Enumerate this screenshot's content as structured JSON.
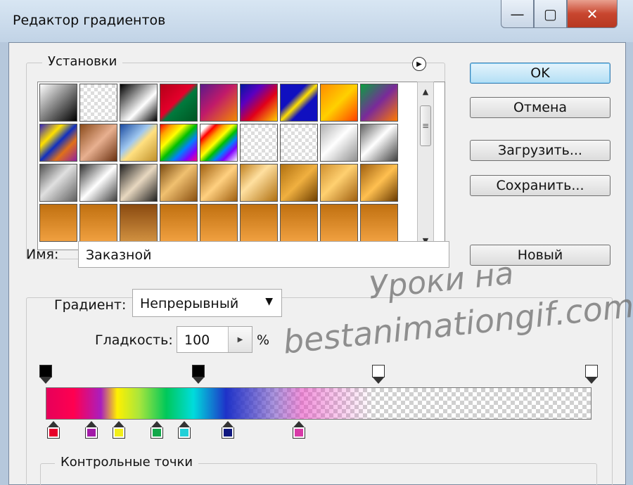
{
  "window": {
    "title": "Редактор градиентов",
    "min_icon": "minimize-icon",
    "max_icon": "maximize-icon",
    "close_icon": "close-icon",
    "min_glyph": "—",
    "max_glyph": "▢",
    "close_glyph": "✕"
  },
  "presets": {
    "legend": "Установки",
    "menu_icon": "triangle-right-icon",
    "menu_glyph": "▶",
    "scroll_up_glyph": "▲",
    "scroll_down_glyph": "▼",
    "thumb_glyph": "≡",
    "swatches": [
      "linear-gradient(135deg,#fff,#000)",
      "repeating-conic-gradient(#ddd 0% 25%, #fff 0% 50%) 0 0/10px 10px",
      "linear-gradient(135deg,#000,#fff 60%,#000)",
      "linear-gradient(135deg,#b30018,#e4002b 45%,#007a3d 55%,#005522)",
      "linear-gradient(135deg,#5a1a8a,#c01a6a 45%,#f28a00)",
      "linear-gradient(135deg,#0018a0,#5a00c0 30%,#e0001a 60%,#ffd000)",
      "linear-gradient(135deg,#1010c0 35%,#ffe000 50%,#1010c0 65%)",
      "linear-gradient(135deg,#ff8c00,#ffd000 50%,#ff4000)",
      "linear-gradient(135deg,#0aa040,#7a2a9a 50%,#ff7a00)",
      "linear-gradient(135deg,#3020c0,#ffe000 30%,#1030c0 50%,#e0701a 70%,#9020a0)",
      "linear-gradient(135deg,#8a4a1a,#e8b090 50%,#6a3010)",
      "linear-gradient(135deg,#1a4aa0,#a0c8f0 40%,#ffe080 55%,#c0902a)",
      "linear-gradient(135deg,#ff0000,#ffa000,#ffff00,#00c000,#0080ff,#8000ff,#ff0080)",
      "linear-gradient(135deg,#fff 10%,#ff0000,#ffa000,#ffff00,#00c000,#0080ff,#8000ff 80%,#fff)",
      "repeating-conic-gradient(#ddd 0% 25%, #fff 0% 50%) 0 0/10px 10px",
      "repeating-conic-gradient(#ddd 0% 25%, #fff 0% 50%) 0 0/10px 10px",
      "linear-gradient(135deg,#b0b0b0,#fff 45%,#909090)",
      "linear-gradient(135deg,#606060,#fff 45%,#404040)",
      "linear-gradient(135deg,#505050,#e0e0e0 45%,#606060)",
      "linear-gradient(135deg,#303030,#ffffff 50%,#404040)",
      "linear-gradient(135deg,#202020,#e8d8c0 50%,#202020)",
      "linear-gradient(135deg,#7a4a10,#f0c070 45%,#8a5010)",
      "linear-gradient(135deg,#a06010,#ffd080 50%,#a06010)",
      "linear-gradient(135deg,#c08020,#ffe0a0 40%,#b07010)",
      "linear-gradient(135deg,#b07010,#f0b040 50%,#704000)",
      "linear-gradient(135deg,#d09030,#ffd070 45%,#a06010)",
      "linear-gradient(135deg,#a06010,#ffc050 50%,#6a3a00)",
      "linear-gradient(180deg,#c07010,#f0a040)",
      "linear-gradient(180deg,#c07010,#f0a040)",
      "linear-gradient(180deg,#8a4a10,#d09040)",
      "linear-gradient(180deg,#c07010,#f0a040)",
      "linear-gradient(180deg,#c07010,#f0a040)",
      "linear-gradient(180deg,#c07010,#f0a040)",
      "linear-gradient(180deg,#c07010,#f0a040)",
      "linear-gradient(180deg,#c07010,#f0a040)",
      "linear-gradient(180deg,#c07010,#f0a040)"
    ]
  },
  "buttons": {
    "ok": "OK",
    "cancel": "Отмена",
    "load": "Загрузить...",
    "save": "Сохранить...",
    "new": "Новый"
  },
  "name_field": {
    "label": "Имя:",
    "value": "Заказной"
  },
  "gradient": {
    "type_label": "Градиент:",
    "type_value": "Непрерывный",
    "smoothness_label": "Гладкость:",
    "smoothness_value": "100",
    "smoothness_unit": "%",
    "opacity_stops": [
      {
        "position": 0.0,
        "color": "#000000"
      },
      {
        "position": 0.28,
        "color": "#000000"
      },
      {
        "position": 0.61,
        "color": "#ffffff"
      },
      {
        "position": 1.0,
        "color": "#ffffff"
      }
    ],
    "color_stops": [
      {
        "position": 0.0,
        "color": "#e8002a"
      },
      {
        "position": 0.07,
        "color": "#a21aa8"
      },
      {
        "position": 0.12,
        "color": "#f2ee1a"
      },
      {
        "position": 0.19,
        "color": "#12a84a"
      },
      {
        "position": 0.24,
        "color": "#20d0d8"
      },
      {
        "position": 0.32,
        "color": "#101880"
      },
      {
        "position": 0.45,
        "color": "#d83aa8"
      }
    ]
  },
  "control_points": {
    "legend": "Контрольные точки"
  },
  "watermark": {
    "line1": "Уроки на",
    "line2": "bestanimationgif.com"
  }
}
